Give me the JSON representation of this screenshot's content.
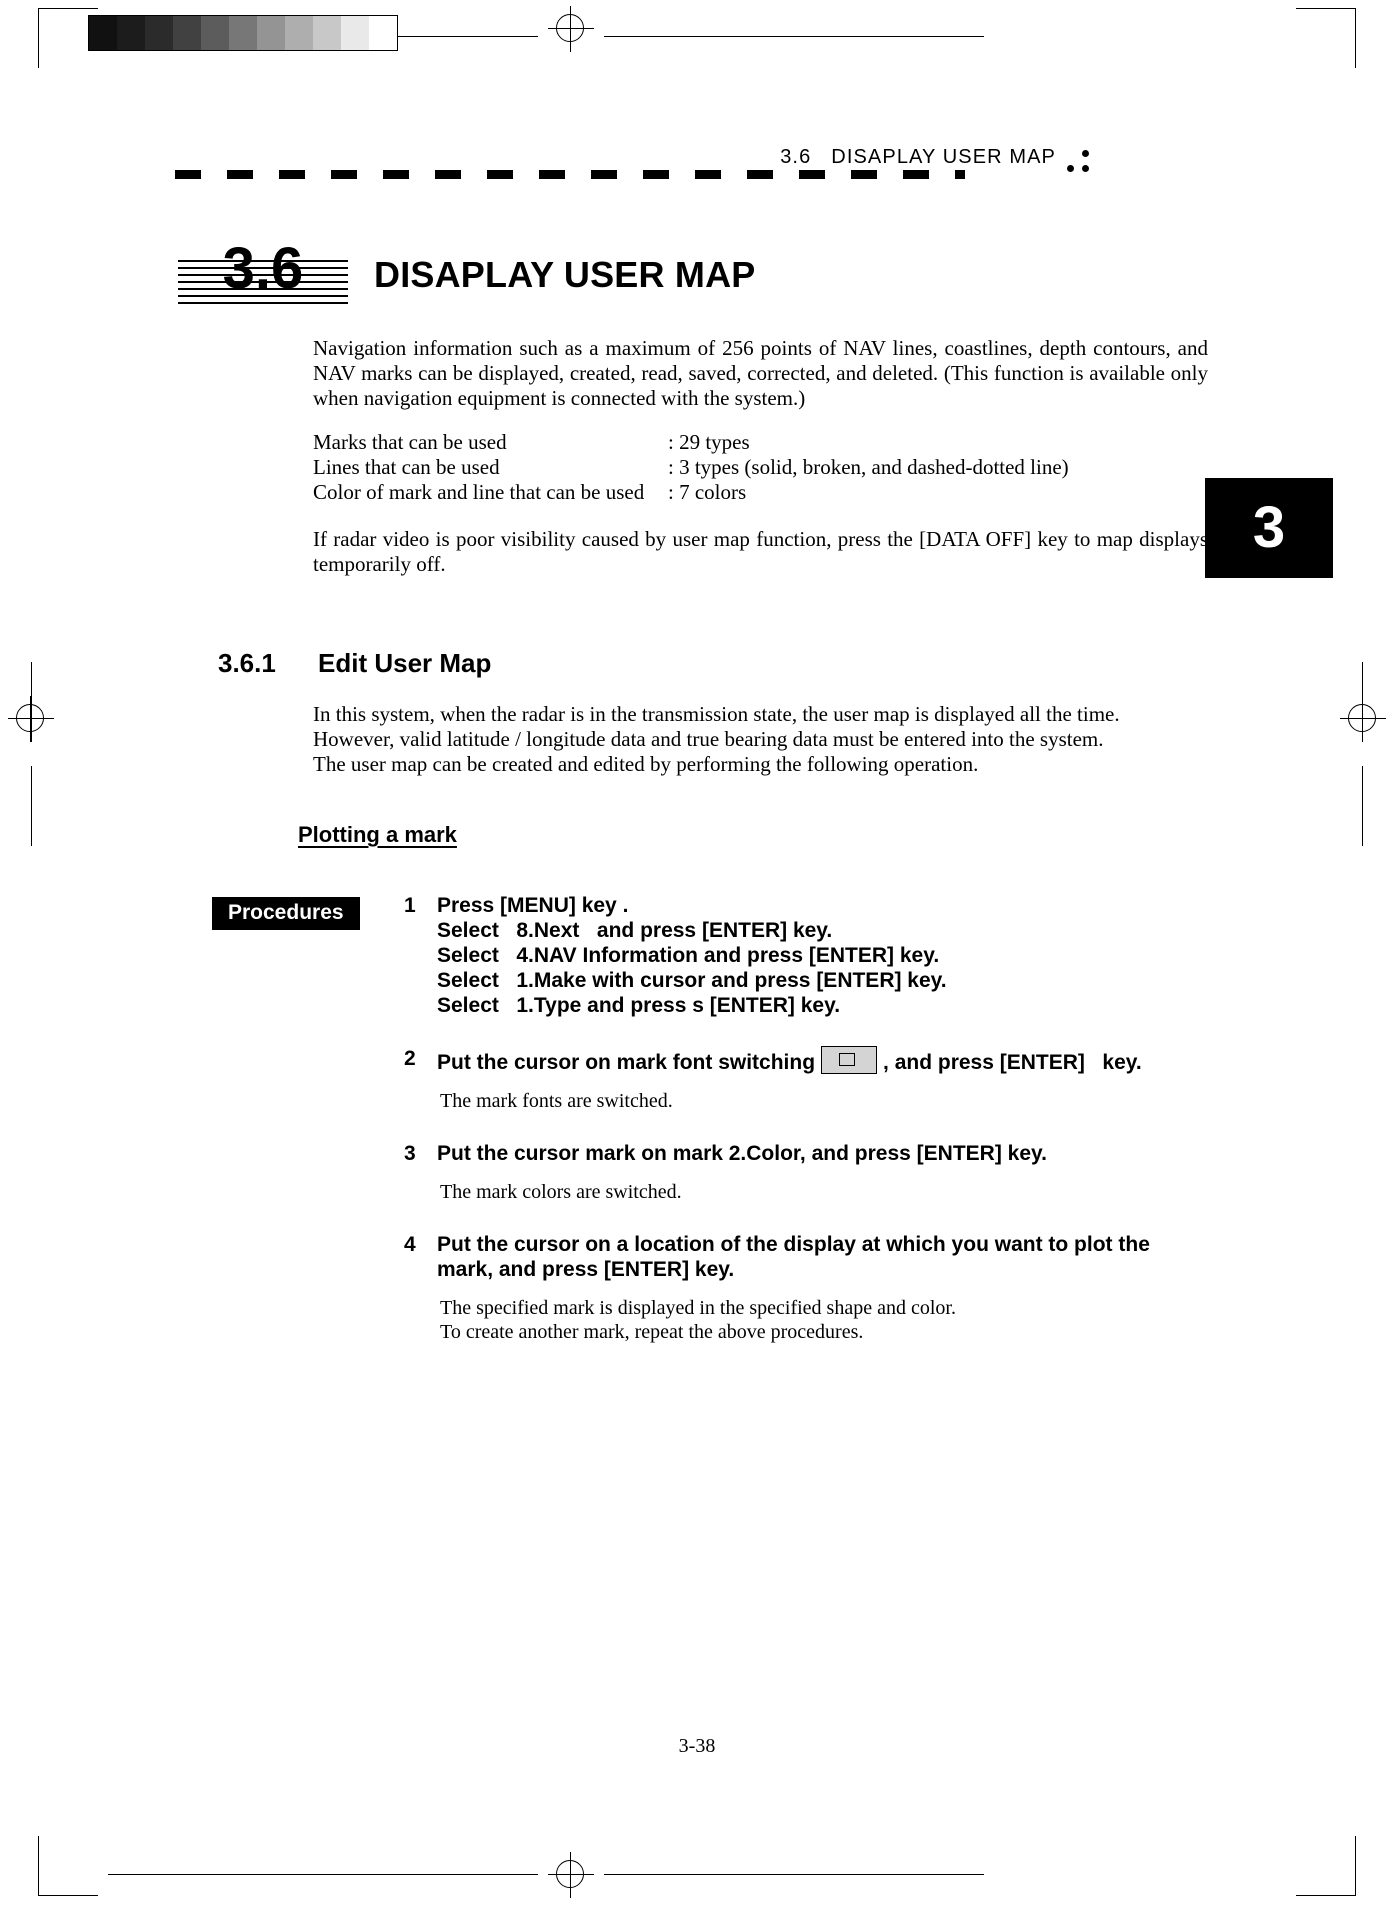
{
  "header": {
    "section_number": "3.6",
    "section_title": "DISAPLAY  USER  MAP",
    "dots_icon": "three-dots-icon"
  },
  "title": {
    "number": "3.6",
    "text": "DISAPLAY USER MAP"
  },
  "chapter_tab": {
    "number": "3"
  },
  "intro": {
    "paragraph": "Navigation information such as a maximum of 256 points of NAV lines, coastlines, depth contours, and NAV marks can be displayed, created, read, saved, corrected, and deleted.   (This function is available only when navigation equipment is connected with the system.)"
  },
  "specs": [
    {
      "label": "Marks that can be used",
      "value": ": 29 types"
    },
    {
      "label": "Lines that can be used",
      "value": ": 3 types (solid, broken, and dashed-dotted line)"
    },
    {
      "label": "Color of mark and line that can be used",
      "value": ": 7 colors"
    }
  ],
  "note": {
    "paragraph": "If radar video is poor visibility caused by user map function, press the [DATA OFF] key to map displays temporarily off."
  },
  "subsection": {
    "number": "3.6.1",
    "title": "Edit User Map",
    "body_line1": "In this system, when the radar is in the transmission state, the user map is displayed all the time.",
    "body_line2": "However, valid latitude / longitude data and true bearing data must be entered into the system.",
    "body_line3": "The user map can be created and edited by performing the following operation."
  },
  "plotting": {
    "heading": "Plotting a mark",
    "procedures_label": "Procedures"
  },
  "steps": [
    {
      "number": "1",
      "text": "Press [MENU] key .",
      "sublines": [
        "Select   8.Next   and press [ENTER] key.",
        "Select   4.NAV Information and press [ENTER] key.",
        "Select   1.Make with cursor and press [ENTER] key.",
        "Select   1.Type and press s [ENTER] key."
      ],
      "result": ""
    },
    {
      "number": "2",
      "text_before": "Put the cursor on mark font switching",
      "text_after": ", and press [ENTER]   key.",
      "key_icon": "mark-font-key-icon",
      "result": "The mark fonts are switched."
    },
    {
      "number": "3",
      "text": "Put the cursor mark on mark 2.Color, and press [ENTER] key.",
      "result": "The mark colors are switched."
    },
    {
      "number": "4",
      "text": "Put the cursor on a location of the display at which you want to plot the\nmark, and press [ENTER] key.",
      "result_line1": "The specified mark is displayed in the specified shape and color.",
      "result_line2": "To create another mark, repeat the above procedures."
    }
  ],
  "footer": {
    "page_number": "3-38"
  },
  "calibration": {
    "name": "grayscale-strip",
    "steps": [
      "#111111",
      "#1c1c1c",
      "#2b2b2b",
      "#414141",
      "#5c5c5c",
      "#777777",
      "#949494",
      "#aeaeae",
      "#c8c8c8",
      "#e9e9e9",
      "#ffffff"
    ]
  }
}
